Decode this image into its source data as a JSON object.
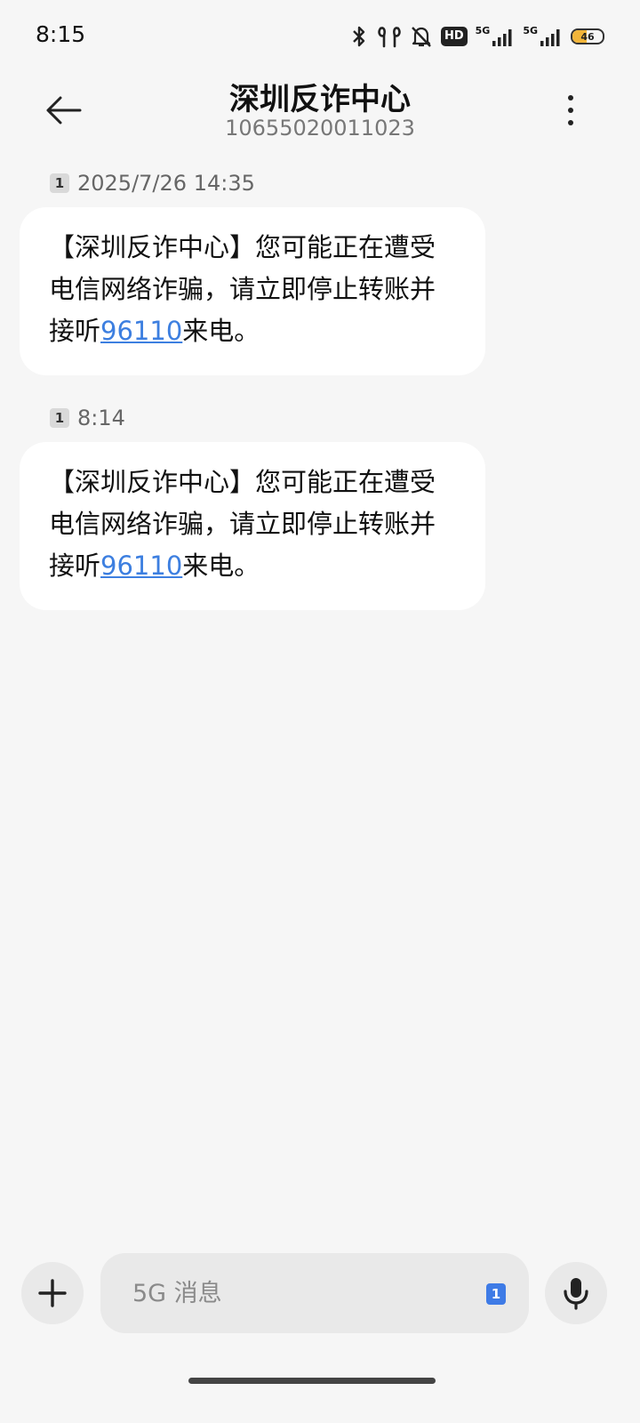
{
  "status_bar": {
    "time": "8:15",
    "hd_label": "HD",
    "network_1": "5G",
    "network_2": "5G",
    "battery": "46",
    "battery_level": 0.46,
    "battery_color": "#f2b53a",
    "icons": [
      "bluetooth-icon",
      "earbuds-icon",
      "silent-bell-icon",
      "hd-voice-icon",
      "signal-icon",
      "signal-icon",
      "battery-icon"
    ]
  },
  "header": {
    "title": "深圳反诈中心",
    "subtitle": "10655020011023"
  },
  "messages": [
    {
      "sim": "1",
      "time": "2025/7/26 14:35",
      "text_before": "【深圳反诈中心】您可能正在遭受电信网络诈骗，请立即停止转账并接听",
      "phone": "96110",
      "text_after": "来电。"
    },
    {
      "sim": "1",
      "time": "8:14",
      "text_before": "【深圳反诈中心】您可能正在遭受电信网络诈骗，请立即停止转账并接听",
      "phone": "96110",
      "text_after": "来电。"
    }
  ],
  "composer": {
    "placeholder": "5G 消息",
    "sim": "1",
    "value": ""
  },
  "colors": {
    "background": "#f6f6f6",
    "bubble": "#ffffff",
    "link": "#3d7fe0",
    "sim_accent": "#3e7be6"
  }
}
